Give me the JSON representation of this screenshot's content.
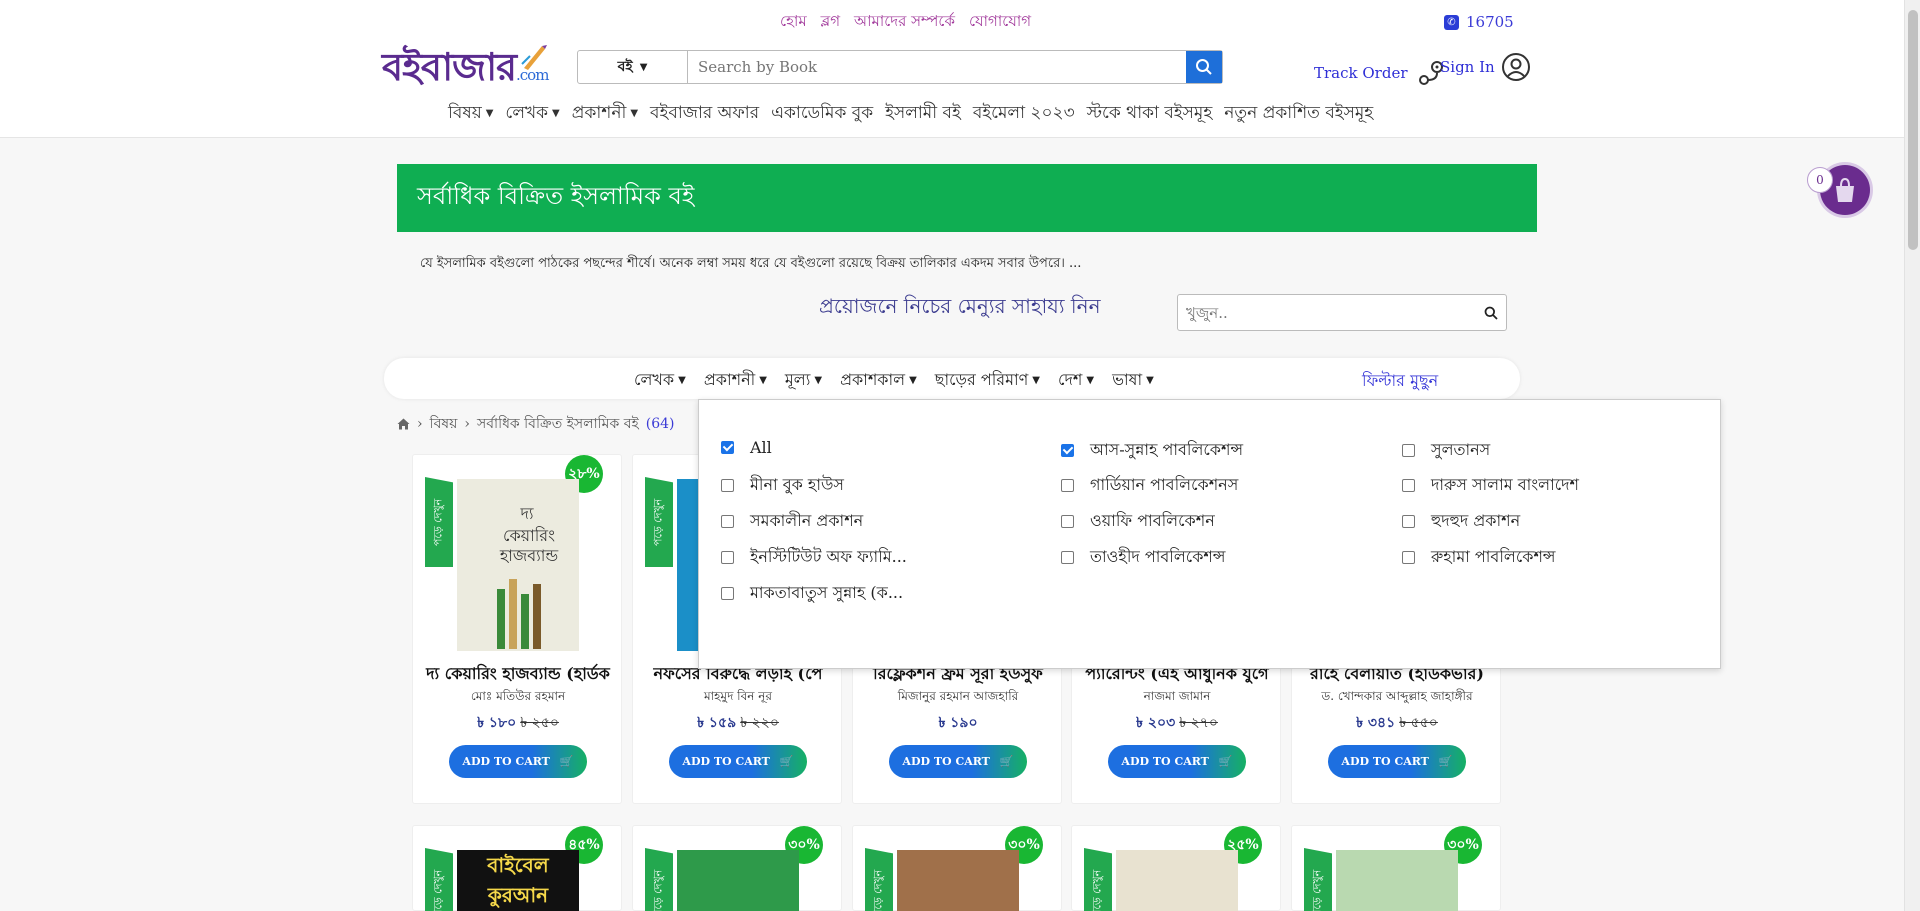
{
  "top_links": [
    "হোম",
    "ব্লগ",
    "আমাদের সম্পর্কে",
    "যোগাযোগ"
  ],
  "phone": "16705",
  "logo": {
    "main": "বইবাজার",
    "suffix": ".com"
  },
  "search": {
    "category": "বই",
    "placeholder": "Search by Book"
  },
  "track_order": "Track Order",
  "sign_in": "Sign In",
  "nav": [
    {
      "label": "বিষয়",
      "dropdown": true
    },
    {
      "label": "লেখক",
      "dropdown": true
    },
    {
      "label": "প্রকাশনী",
      "dropdown": true
    },
    {
      "label": "বইবাজার অফার",
      "dropdown": false
    },
    {
      "label": "একাডেমিক বুক",
      "dropdown": false
    },
    {
      "label": "ইসলামী বই",
      "dropdown": false
    },
    {
      "label": "বইমেলা ২০২৩",
      "dropdown": false
    },
    {
      "label": "স্টকে থাকা বইসমূহ",
      "dropdown": false
    },
    {
      "label": "নতুন প্রকাশিত বইসমূহ",
      "dropdown": false
    }
  ],
  "banner_title": "সর্বাধিক বিক্রিত ইসলামিক বই",
  "description": "যে ইসলামিক বইগুলো পাঠকের পছন্দের শীর্ষে। অনেক লম্বা সময় ধরে যে বইগুলো রয়েছে বিক্রয় তালিকার একদম সবার উপরে। ...",
  "help_text": "প্রয়োজনে নিচের মেন্যুর সাহায্য নিন",
  "filter_search_placeholder": "খুজুন..",
  "filters": [
    "লেখক",
    "প্রকাশনী",
    "মূল্য",
    "প্রকাশকাল",
    "ছাড়ের পরিমাণ",
    "দেশ",
    "ভাষা"
  ],
  "filter_clear": "ফিল্টার মুছুন",
  "breadcrumb": {
    "home_icon": "home-icon",
    "category": "বিষয়",
    "current": "সর্বাধিক বিক্রিত ইসলামিক বই",
    "count": "(64)"
  },
  "publisher_options": [
    {
      "label": "All",
      "checked": true
    },
    {
      "label": "আস-সুন্নাহ পাবলিকেশন্স",
      "checked": true
    },
    {
      "label": "সুলতানস",
      "checked": false
    },
    {
      "label": "মীনা বুক হাউস",
      "checked": false
    },
    {
      "label": "গার্ডিয়ান পাবলিকেশনস",
      "checked": false
    },
    {
      "label": "দারুস সালাম বাংলাদেশ",
      "checked": false
    },
    {
      "label": "সমকালীন প্রকাশন",
      "checked": false
    },
    {
      "label": "ওয়াফি পাবলিকেশন",
      "checked": false
    },
    {
      "label": "হুদহুদ প্রকাশন",
      "checked": false
    },
    {
      "label": "ইনস্টিটিউট অফ ফ্যামি...",
      "checked": false
    },
    {
      "label": "তাওহীদ পাবলিকেশন্স",
      "checked": false
    },
    {
      "label": "রুহামা পাবলিকেশন্স",
      "checked": false
    },
    {
      "label": "মাকতাবাতুস সুন্নাহ (ক...",
      "checked": false
    }
  ],
  "ribbon_text": "পড়ে দেখুন",
  "add_to_cart": "ADD TO CART",
  "cart_count": "0",
  "books": [
    {
      "title": "দ্য কেয়ারিং হাজব্যান্ড (হার্ডক",
      "author": "মোঃ মতিউর রহমান",
      "price": "৳ ১৮০",
      "old_price": "৳ ২৫০",
      "discount": "২৮%"
    },
    {
      "title": "নফসের বিরুদ্ধে লড়াই (পে",
      "author": "মাহমুদ বিন নূর",
      "price": "৳ ১৫৯",
      "old_price": "৳ ২২০",
      "discount": ""
    },
    {
      "title": "রিফ্লেকশন ফ্রম সূরা ইউসুফ",
      "author": "মিজানুর রহমান আজহারি",
      "price": "৳ ১৯০",
      "old_price": "",
      "discount": ""
    },
    {
      "title": "প্যারেন্টিং (এই আধুনিক যুগে",
      "author": "নাজমা জামান",
      "price": "৳ ২০৩",
      "old_price": "৳ ২৭০",
      "discount": ""
    },
    {
      "title": "রাহে বেলায়াত (হার্ডকভার)",
      "author": "ড. খোন্দকার আব্দুল্লাহ জাহাঙ্গীর",
      "price": "৳ ৩৪১",
      "old_price": "৳ ৫৫০",
      "discount": ""
    }
  ],
  "books_row2": [
    {
      "discount": "৪৫%",
      "cover_text": "বাইবেল কুরআন"
    },
    {
      "discount": "৩০%",
      "cover_text": ""
    },
    {
      "discount": "৩০%",
      "cover_text": ""
    },
    {
      "discount": "২৫%",
      "cover_text": ""
    },
    {
      "discount": "৩০%",
      "cover_text": ""
    }
  ]
}
